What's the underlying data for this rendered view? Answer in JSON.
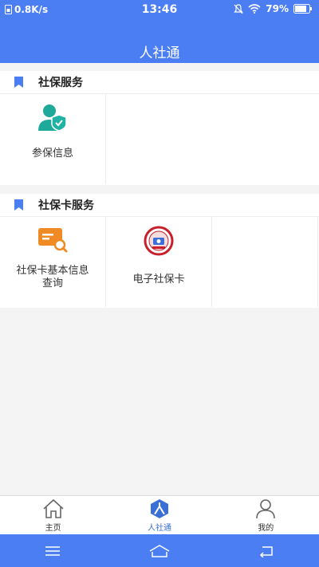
{
  "status": {
    "speed": "0.8K/s",
    "time": "13:46",
    "battery": "79%"
  },
  "header": {
    "title": "人社通"
  },
  "sections": [
    {
      "title": "社保服务",
      "items": [
        {
          "label": "参保信息",
          "icon": "person-shield-icon"
        }
      ]
    },
    {
      "title": "社保卡服务",
      "items": [
        {
          "label": "社保卡基本信息查询",
          "icon": "card-search-icon"
        },
        {
          "label": "电子社保卡",
          "icon": "e-card-emblem-icon"
        }
      ]
    }
  ],
  "tabs": [
    {
      "label": "主页",
      "icon": "home-icon"
    },
    {
      "label": "人社通",
      "icon": "people-hex-icon",
      "active": true
    },
    {
      "label": "我的",
      "icon": "user-icon"
    }
  ],
  "colors": {
    "primary": "#4b7ef3",
    "active_tab": "#3a6fd8",
    "teal": "#1fa99a",
    "orange": "#f08a24"
  }
}
